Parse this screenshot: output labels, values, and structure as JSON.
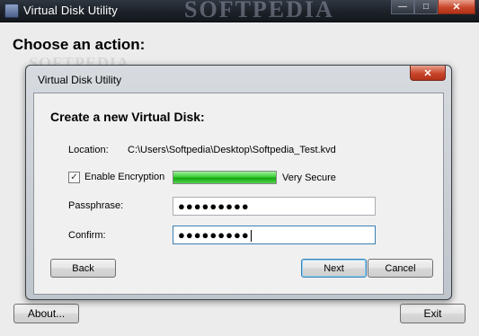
{
  "window": {
    "title": "Virtual Disk Utility",
    "watermark": "SOFTPEDIA",
    "minimize": "—",
    "maximize": "□",
    "close": "✕"
  },
  "main": {
    "heading": "Choose an action:",
    "about_label": "About...",
    "exit_label": "Exit"
  },
  "dialog": {
    "title": "Virtual Disk Utility",
    "close": "✕",
    "heading": "Create a new Virtual Disk:",
    "location_label": "Location:",
    "location_value": "C:\\Users\\Softpedia\\Desktop\\Softpedia_Test.kvd",
    "encryption_checked": true,
    "encryption_label": "Enable Encryption",
    "strength_fraction": 1.0,
    "strength_text": "Very Secure",
    "passphrase_label": "Passphrase:",
    "passphrase_value": "●●●●●●●●●",
    "confirm_label": "Confirm:",
    "confirm_value": "●●●●●●●●●",
    "back_label": "Back",
    "next_label": "Next",
    "cancel_label": "Cancel"
  },
  "colors": {
    "strength": "#11a80d",
    "close_button": "#c8462b"
  }
}
